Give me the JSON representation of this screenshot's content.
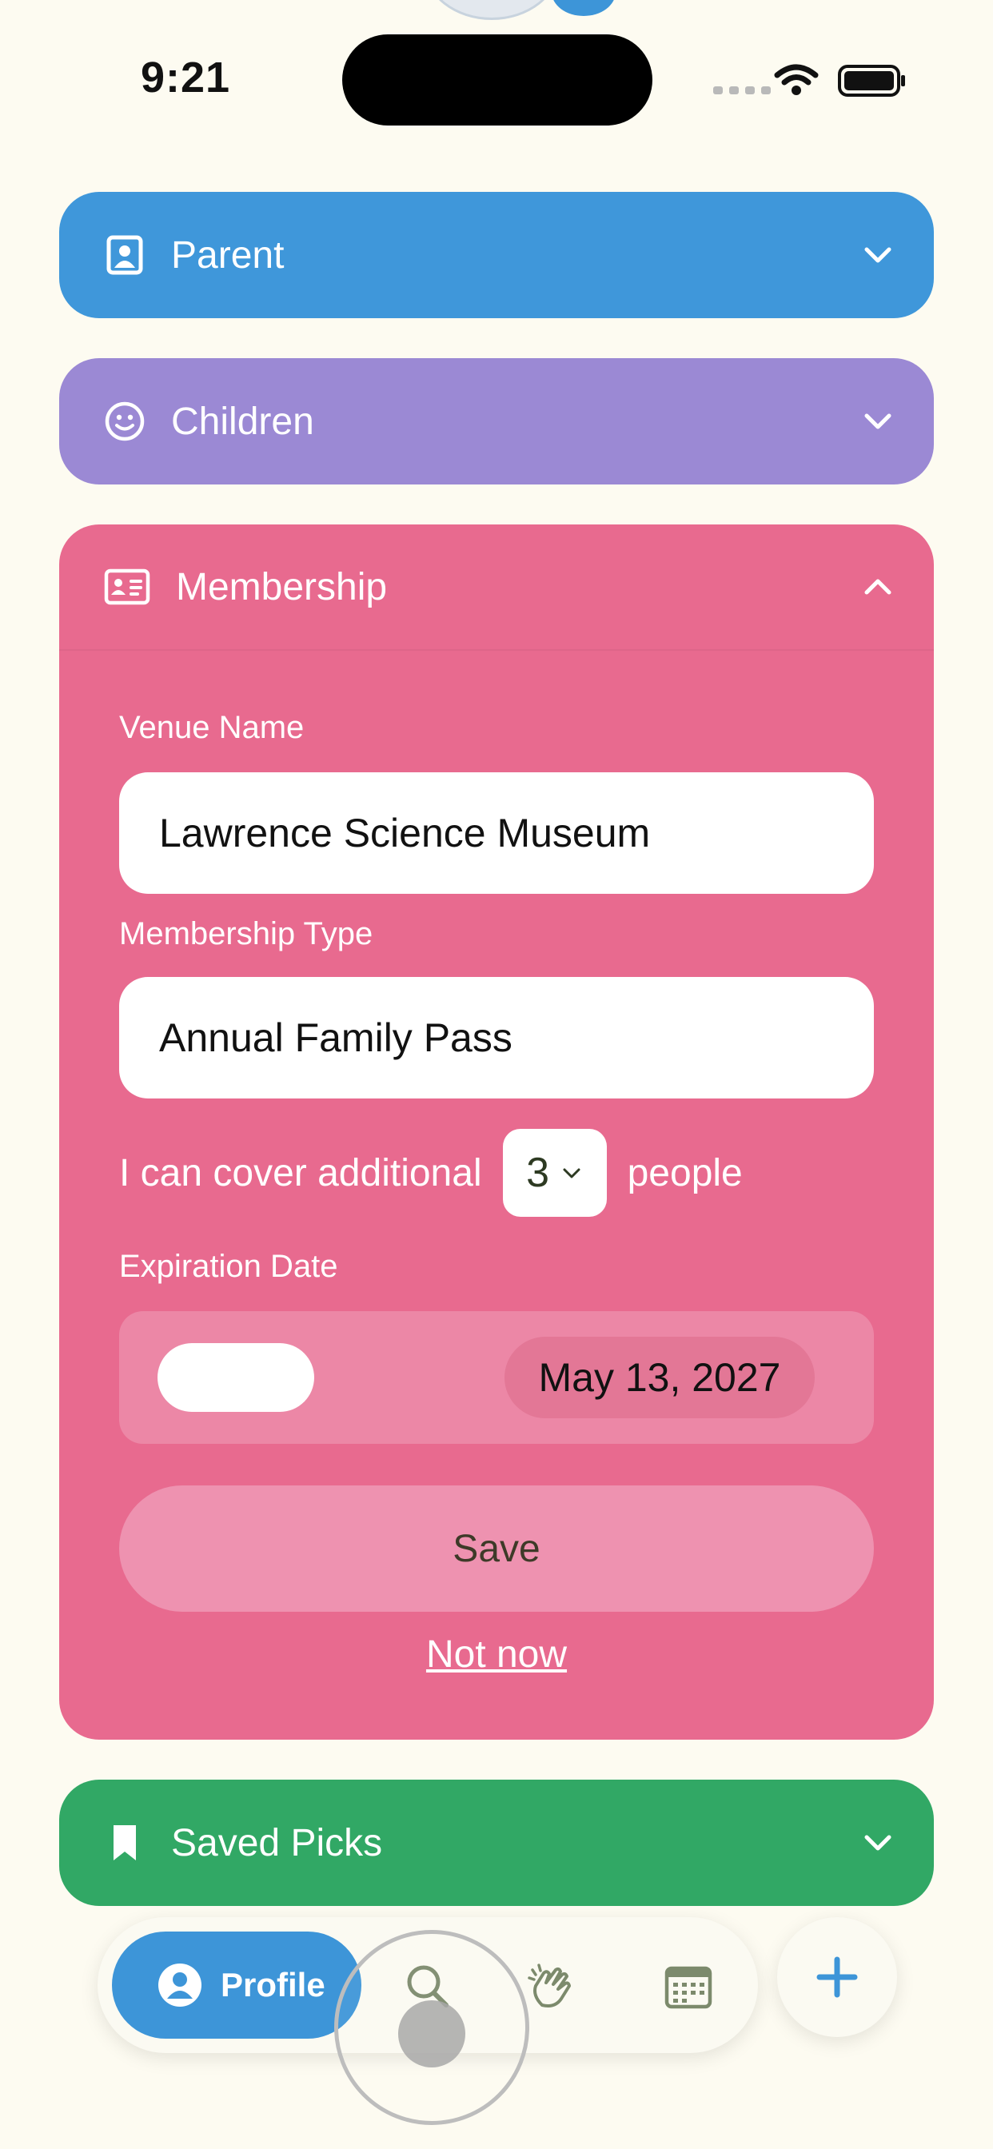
{
  "status_bar": {
    "time": "9:21"
  },
  "sections": {
    "parent": {
      "title": "Parent"
    },
    "children": {
      "title": "Children"
    },
    "membership": {
      "title": "Membership",
      "venue_label": "Venue Name",
      "venue_value": "Lawrence Science Museum",
      "type_label": "Membership Type",
      "type_value": "Annual Family Pass",
      "cover_prefix": "I can cover additional",
      "cover_count": "3",
      "cover_suffix": "people",
      "expiration_label": "Expiration Date",
      "expiration_date": "May 13, 2027",
      "save_label": "Save",
      "not_now_label": "Not now"
    },
    "saved_picks": {
      "title": "Saved Picks"
    }
  },
  "tab_bar": {
    "profile_label": "Profile",
    "items": [
      "search-icon",
      "clapping-hands-icon",
      "calendar-icon"
    ]
  },
  "colors": {
    "parent": "#3f97da",
    "children": "#9b89d4",
    "membership": "#e86a8f",
    "saved_picks": "#31a865",
    "accent": "#3d95d8",
    "background": "#fdfbf1"
  }
}
